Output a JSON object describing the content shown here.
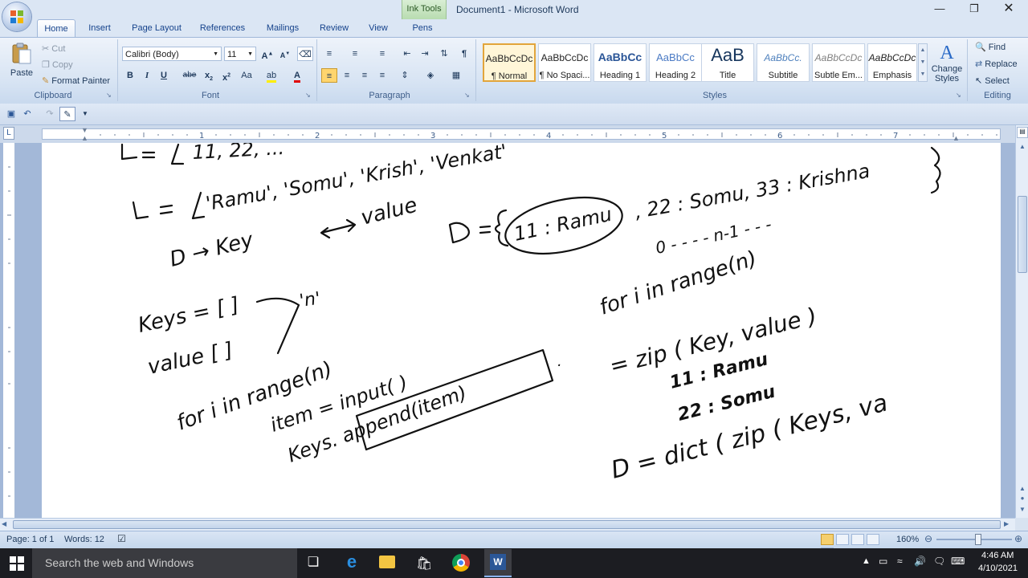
{
  "window": {
    "context_tab": "Ink Tools",
    "title": "Document1 - Microsoft Word",
    "minimize_icon": "minimize-icon",
    "restore_icon": "restore-icon",
    "close_icon": "close-icon"
  },
  "tabs": [
    {
      "label": "Home",
      "active": true
    },
    {
      "label": "Insert"
    },
    {
      "label": "Page Layout"
    },
    {
      "label": "References"
    },
    {
      "label": "Mailings"
    },
    {
      "label": "Review"
    },
    {
      "label": "View"
    },
    {
      "label": "Pens"
    }
  ],
  "ribbon": {
    "clipboard": {
      "paste": "Paste",
      "cut": "Cut",
      "copy": "Copy",
      "format_painter": "Format Painter",
      "label": "Clipboard"
    },
    "font": {
      "font_name": "Calibri (Body)",
      "font_size": "11",
      "label": "Font"
    },
    "paragraph": {
      "label": "Paragraph"
    },
    "styles": {
      "label": "Styles",
      "items": [
        {
          "preview": "AaBbCcDc",
          "name": "¶ Normal"
        },
        {
          "preview": "AaBbCcDc",
          "name": "¶ No Spaci..."
        },
        {
          "preview": "AaBbCc",
          "name": "Heading 1"
        },
        {
          "preview": "AaBbCc",
          "name": "Heading 2"
        },
        {
          "preview": "AaB",
          "name": "Title"
        },
        {
          "preview": "AaBbCc.",
          "name": "Subtitle"
        },
        {
          "preview": "AaBbCcDc",
          "name": "Subtle Em..."
        },
        {
          "preview": "AaBbCcDc",
          "name": "Emphasis"
        }
      ],
      "change_styles": "Change Styles"
    },
    "editing": {
      "find": "Find",
      "replace": "Replace",
      "select": "Select",
      "label": "Editing"
    }
  },
  "ruler": {
    "numbers": [
      "1",
      "2",
      "3",
      "4",
      "5",
      "6",
      "7"
    ]
  },
  "ink": {
    "lines": [
      "L₁ = [ 11, 22, ...",
      "L₂ = [ 'Ramu', 'Somu', 'Krish', 'Venkat'",
      "D → Key ↔ value",
      "D = { 11 : Ramu , 22 : Somu, 33 : Krishna }",
      "0 - - - - n-1 - - -",
      "for i in range(n)",
      "Keys = [ ]",
      "value [ ]",
      "'n'",
      "for i in range(n)",
      "item = input( )",
      "Keys.append(item)",
      "= zip ( Key, value )",
      "11 : Ramu",
      "22 : Somu",
      "D = dict ( zip ( Keys, va"
    ]
  },
  "status": {
    "page": "Page: 1 of 1",
    "words": "Words: 12",
    "zoom": "160%"
  },
  "taskbar": {
    "search_placeholder": "Search the web and Windows",
    "time": "4:46 AM",
    "date": "4/10/2021"
  }
}
